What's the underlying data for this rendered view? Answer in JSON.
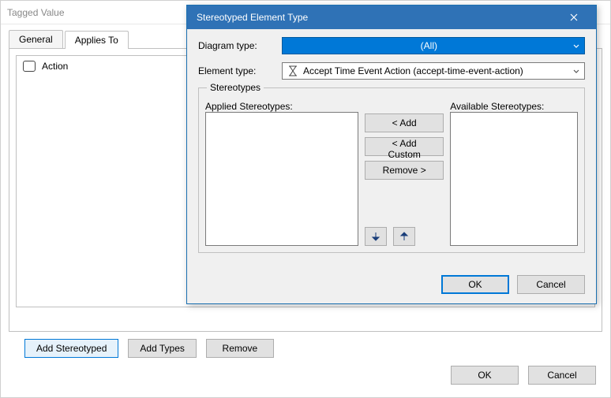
{
  "parent": {
    "title": "Tagged Value",
    "tabs": {
      "general": "General",
      "applies_to": "Applies To"
    },
    "applies_items": [
      {
        "icon": "action-rect-icon",
        "label": "Action"
      }
    ],
    "buttons": {
      "add_stereotyped": "Add Stereotyped",
      "add_types": "Add Types",
      "remove": "Remove",
      "ok": "OK",
      "cancel": "Cancel"
    }
  },
  "modal": {
    "title": "Stereotyped Element Type",
    "labels": {
      "diagram_type": "Diagram type:",
      "element_type": "Element type:",
      "stereotypes_group": "Stereotypes",
      "applied": "Applied Stereotypes:",
      "available": "Available Stereotypes:"
    },
    "diagram_type_value": "(All)",
    "element_type_value": "Accept Time Event Action (accept-time-event-action)",
    "buttons": {
      "add": "< Add",
      "add_custom": "< Add Custom",
      "remove": "Remove >",
      "ok": "OK",
      "cancel": "Cancel"
    }
  }
}
